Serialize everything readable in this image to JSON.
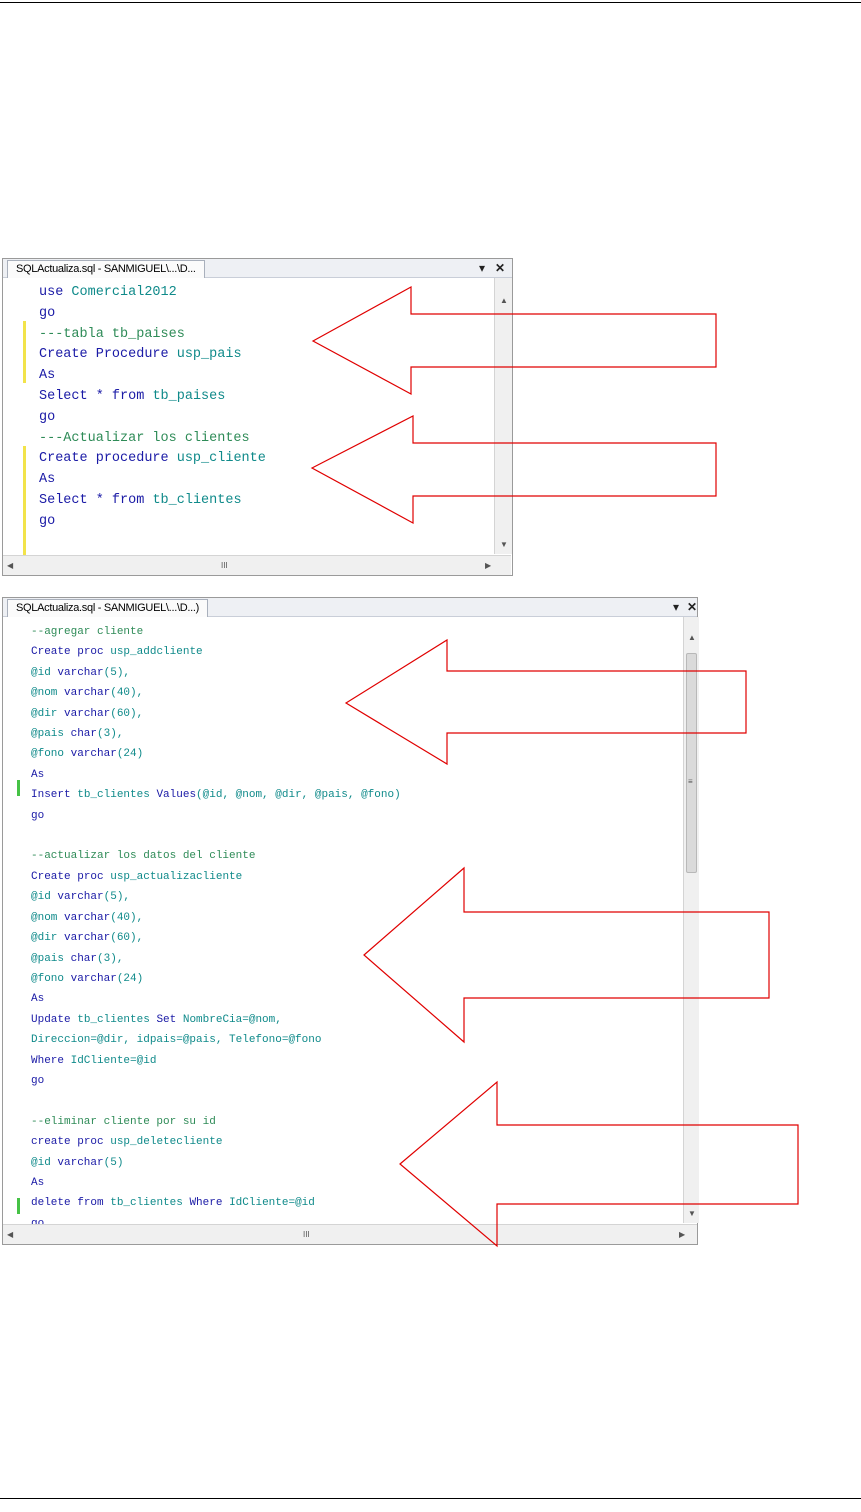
{
  "editor1": {
    "tab_title": "SQLActualiza.sql - SANMIGUEL\\...\\D...",
    "dropdown_glyph": "▾",
    "close_glyph": "✕",
    "hscroll_glyph": "III",
    "lines": [
      [
        {
          "t": "use ",
          "c": "kw"
        },
        {
          "t": "Comercial2012",
          "c": "id"
        }
      ],
      [
        {
          "t": "go",
          "c": "kw"
        }
      ],
      [
        {
          "t": "---tabla tb_paises",
          "c": "cm"
        }
      ],
      [
        {
          "t": "Create ",
          "c": "kw"
        },
        {
          "t": "Procedure ",
          "c": "kw"
        },
        {
          "t": "usp_pais",
          "c": "id"
        }
      ],
      [
        {
          "t": "As",
          "c": "kw"
        }
      ],
      [
        {
          "t": "Select ",
          "c": "kw"
        },
        {
          "t": "* ",
          "c": "kw"
        },
        {
          "t": "from ",
          "c": "kw"
        },
        {
          "t": "tb_paises",
          "c": "id"
        }
      ],
      [
        {
          "t": "go",
          "c": "kw"
        }
      ],
      [
        {
          "t": "---Actualizar los clientes",
          "c": "cm"
        }
      ],
      [
        {
          "t": "Create ",
          "c": "kw"
        },
        {
          "t": "procedure ",
          "c": "kw"
        },
        {
          "t": "usp_cliente",
          "c": "id"
        }
      ],
      [
        {
          "t": "As",
          "c": "kw"
        }
      ],
      [
        {
          "t": "Select ",
          "c": "kw"
        },
        {
          "t": "* ",
          "c": "kw"
        },
        {
          "t": "from ",
          "c": "kw"
        },
        {
          "t": "tb_clientes",
          "c": "id"
        }
      ],
      [
        {
          "t": "go",
          "c": "kw"
        }
      ]
    ]
  },
  "editor2": {
    "tab_title": "SQLActualiza.sql - SANMIGUEL\\...\\D...)",
    "dropdown_glyph": "▾",
    "close_glyph": "✕",
    "hscroll_glyph": "III",
    "vscroll_grip": "≡",
    "lines": [
      [
        {
          "t": "--agregar cliente",
          "c": "cm"
        }
      ],
      [
        {
          "t": "Create ",
          "c": "kw"
        },
        {
          "t": "proc ",
          "c": "kw"
        },
        {
          "t": "usp_addcliente",
          "c": "id"
        }
      ],
      [
        {
          "t": "@id ",
          "c": "id"
        },
        {
          "t": "varchar",
          "c": "ty"
        },
        {
          "t": "(5),",
          "c": "id"
        }
      ],
      [
        {
          "t": "@nom ",
          "c": "id"
        },
        {
          "t": "varchar",
          "c": "ty"
        },
        {
          "t": "(40),",
          "c": "id"
        }
      ],
      [
        {
          "t": "@dir ",
          "c": "id"
        },
        {
          "t": "varchar",
          "c": "ty"
        },
        {
          "t": "(60),",
          "c": "id"
        }
      ],
      [
        {
          "t": "@pais ",
          "c": "id"
        },
        {
          "t": "char",
          "c": "ty"
        },
        {
          "t": "(3),",
          "c": "id"
        }
      ],
      [
        {
          "t": "@fono ",
          "c": "id"
        },
        {
          "t": "varchar",
          "c": "ty"
        },
        {
          "t": "(24)",
          "c": "id"
        }
      ],
      [
        {
          "t": "As",
          "c": "kw"
        }
      ],
      [
        {
          "t": "Insert ",
          "c": "kw"
        },
        {
          "t": "tb_clientes ",
          "c": "id"
        },
        {
          "t": "Values",
          "c": "kw"
        },
        {
          "t": "(@id, @nom, @dir, @pais, @fono)",
          "c": "id"
        }
      ],
      [
        {
          "t": "go",
          "c": "kw"
        }
      ],
      [
        {
          "t": "",
          "c": "id"
        }
      ],
      [
        {
          "t": "--actualizar los datos del cliente",
          "c": "cm"
        }
      ],
      [
        {
          "t": "Create ",
          "c": "kw"
        },
        {
          "t": "proc ",
          "c": "kw"
        },
        {
          "t": "usp_actualizacliente",
          "c": "id"
        }
      ],
      [
        {
          "t": "@id ",
          "c": "id"
        },
        {
          "t": "varchar",
          "c": "ty"
        },
        {
          "t": "(5),",
          "c": "id"
        }
      ],
      [
        {
          "t": "@nom ",
          "c": "id"
        },
        {
          "t": "varchar",
          "c": "ty"
        },
        {
          "t": "(40),",
          "c": "id"
        }
      ],
      [
        {
          "t": "@dir ",
          "c": "id"
        },
        {
          "t": "varchar",
          "c": "ty"
        },
        {
          "t": "(60),",
          "c": "id"
        }
      ],
      [
        {
          "t": "@pais ",
          "c": "id"
        },
        {
          "t": "char",
          "c": "ty"
        },
        {
          "t": "(3),",
          "c": "id"
        }
      ],
      [
        {
          "t": "@fono ",
          "c": "id"
        },
        {
          "t": "varchar",
          "c": "ty"
        },
        {
          "t": "(24)",
          "c": "id"
        }
      ],
      [
        {
          "t": "As",
          "c": "kw"
        }
      ],
      [
        {
          "t": "Update ",
          "c": "kw"
        },
        {
          "t": "tb_clientes ",
          "c": "id"
        },
        {
          "t": "Set ",
          "c": "kw"
        },
        {
          "t": "NombreCia=@nom,",
          "c": "id"
        }
      ],
      [
        {
          "t": "Direccion=@dir, idpais=@pais, Telefono=@fono",
          "c": "id"
        }
      ],
      [
        {
          "t": "Where ",
          "c": "kw"
        },
        {
          "t": "IdCliente=@id",
          "c": "id"
        }
      ],
      [
        {
          "t": "go",
          "c": "kw"
        }
      ],
      [
        {
          "t": "",
          "c": "id"
        }
      ],
      [
        {
          "t": "--eliminar cliente por su id",
          "c": "cm"
        }
      ],
      [
        {
          "t": "create ",
          "c": "kw"
        },
        {
          "t": "proc ",
          "c": "kw"
        },
        {
          "t": "usp_deletecliente",
          "c": "id"
        }
      ],
      [
        {
          "t": "@id ",
          "c": "id"
        },
        {
          "t": "varchar",
          "c": "ty"
        },
        {
          "t": "(5)",
          "c": "id"
        }
      ],
      [
        {
          "t": "As",
          "c": "kw"
        }
      ],
      [
        {
          "t": "delete ",
          "c": "kw"
        },
        {
          "t": "from ",
          "c": "kw"
        },
        {
          "t": "tb_clientes ",
          "c": "id"
        },
        {
          "t": "Where ",
          "c": "kw"
        },
        {
          "t": "IdCliente=@id",
          "c": "id"
        }
      ],
      [
        {
          "t": "go",
          "c": "kw"
        }
      ]
    ]
  },
  "colors": {
    "keyword": "#1a1aa6",
    "comment": "#2e8b57",
    "identifier": "#0f8a8a",
    "arrow_stroke": "#e00000",
    "change_marker_yellow": "#f2e34a",
    "change_marker_green": "#46c246"
  },
  "annotations": {
    "arrow_count": 5,
    "arrow_direction": "left"
  }
}
